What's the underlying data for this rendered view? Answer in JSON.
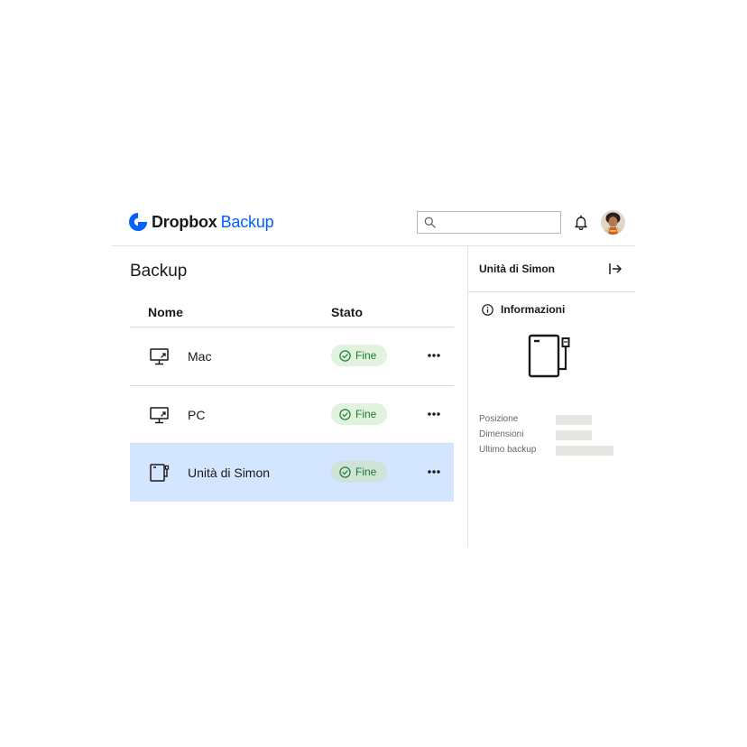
{
  "header": {
    "brand": "Dropbox",
    "product": "Backup",
    "search": {
      "placeholder": "",
      "value": ""
    },
    "icons": {
      "logo": "dropbox-logo-icon",
      "search": "search-icon",
      "notifications": "bell-icon",
      "avatar": "user-avatar"
    }
  },
  "main": {
    "title": "Backup",
    "columns": {
      "name": "Nome",
      "status": "Stato"
    },
    "rows": [
      {
        "name": "Mac",
        "status": "Fine",
        "icon": "computer-backup-icon",
        "selected": false
      },
      {
        "name": "PC",
        "status": "Fine",
        "icon": "computer-backup-icon",
        "selected": false
      },
      {
        "name": "Unità di Simon",
        "status": "Fine",
        "icon": "external-drive-icon",
        "selected": true
      }
    ]
  },
  "panel": {
    "title": "Unità di Simon",
    "section_label": "Informazioni",
    "fields": [
      {
        "label": "Posizione"
      },
      {
        "label": "Dimensioni"
      },
      {
        "label": "Ultimo backup"
      }
    ]
  },
  "colors": {
    "accent": "#0061fe",
    "selected_row": "#d4e5ff",
    "status_bg": "#e1f2df",
    "status_text": "#1a7d2e"
  }
}
